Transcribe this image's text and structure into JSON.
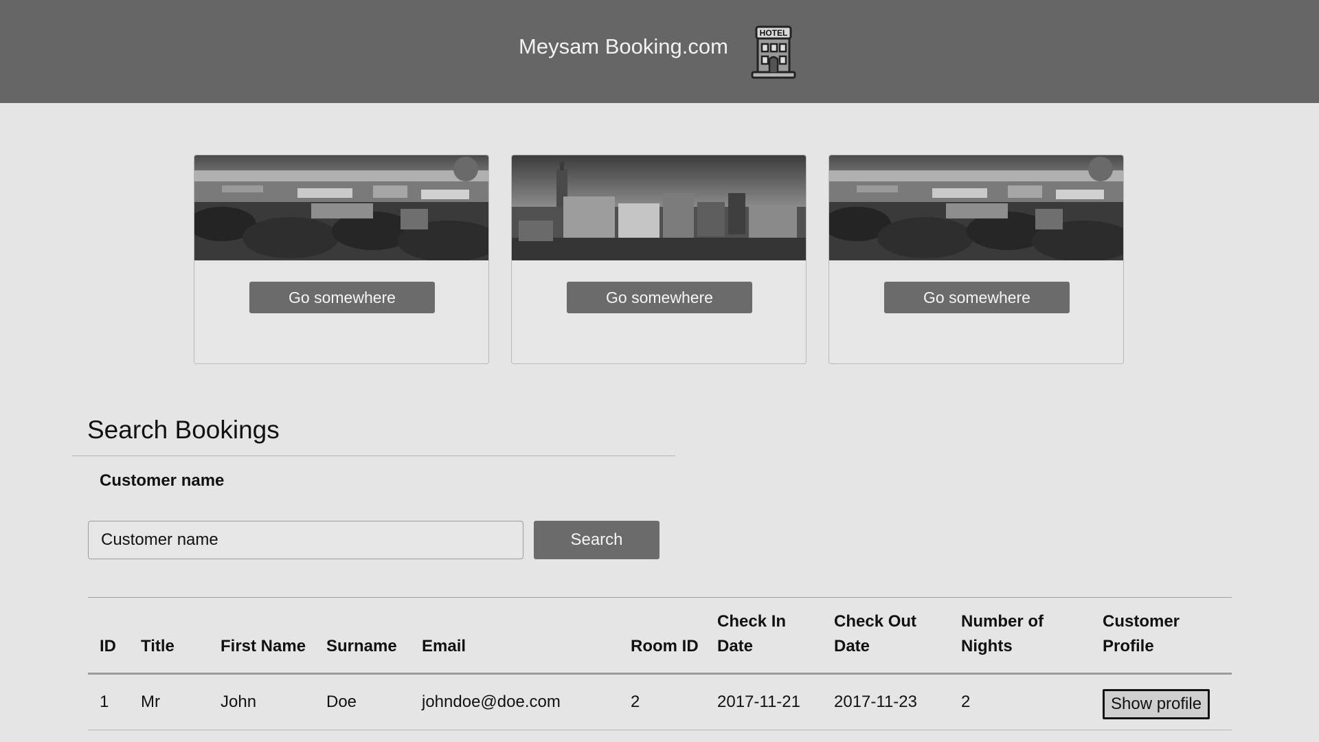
{
  "header": {
    "brand": "Meysam Booking.com",
    "icon": "hotel-icon",
    "icon_text": "HOTEL",
    "background": "#666666"
  },
  "cards": [
    {
      "image": "city-park-aerial-photo",
      "button_label": "Go somewhere"
    },
    {
      "image": "city-center-aerial-photo",
      "button_label": "Go somewhere"
    },
    {
      "image": "city-park-aerial-photo",
      "button_label": "Go somewhere"
    }
  ],
  "search": {
    "title": "Search Bookings",
    "field_label": "Customer name",
    "input_placeholder": "Customer name",
    "input_value": "",
    "button_label": "Search"
  },
  "bookings": {
    "columns": [
      "ID",
      "Title",
      "First Name",
      "Surname",
      "Email",
      "Room ID",
      "Check In Date",
      "Check Out Date",
      "Number of Nights",
      "Customer Profile"
    ],
    "rows": [
      {
        "id": "1",
        "title": "Mr",
        "first_name": "John",
        "surname": "Doe",
        "email": "johndoe@doe.com",
        "room_id": "2",
        "check_in": "2017-11-21",
        "check_out": "2017-11-23",
        "nights": "2",
        "profile_button": "Show profile"
      }
    ]
  },
  "colors": {
    "page_background": "#e5e5e5",
    "button": "#6b6b6b",
    "button_text": "#f5f5f5"
  }
}
